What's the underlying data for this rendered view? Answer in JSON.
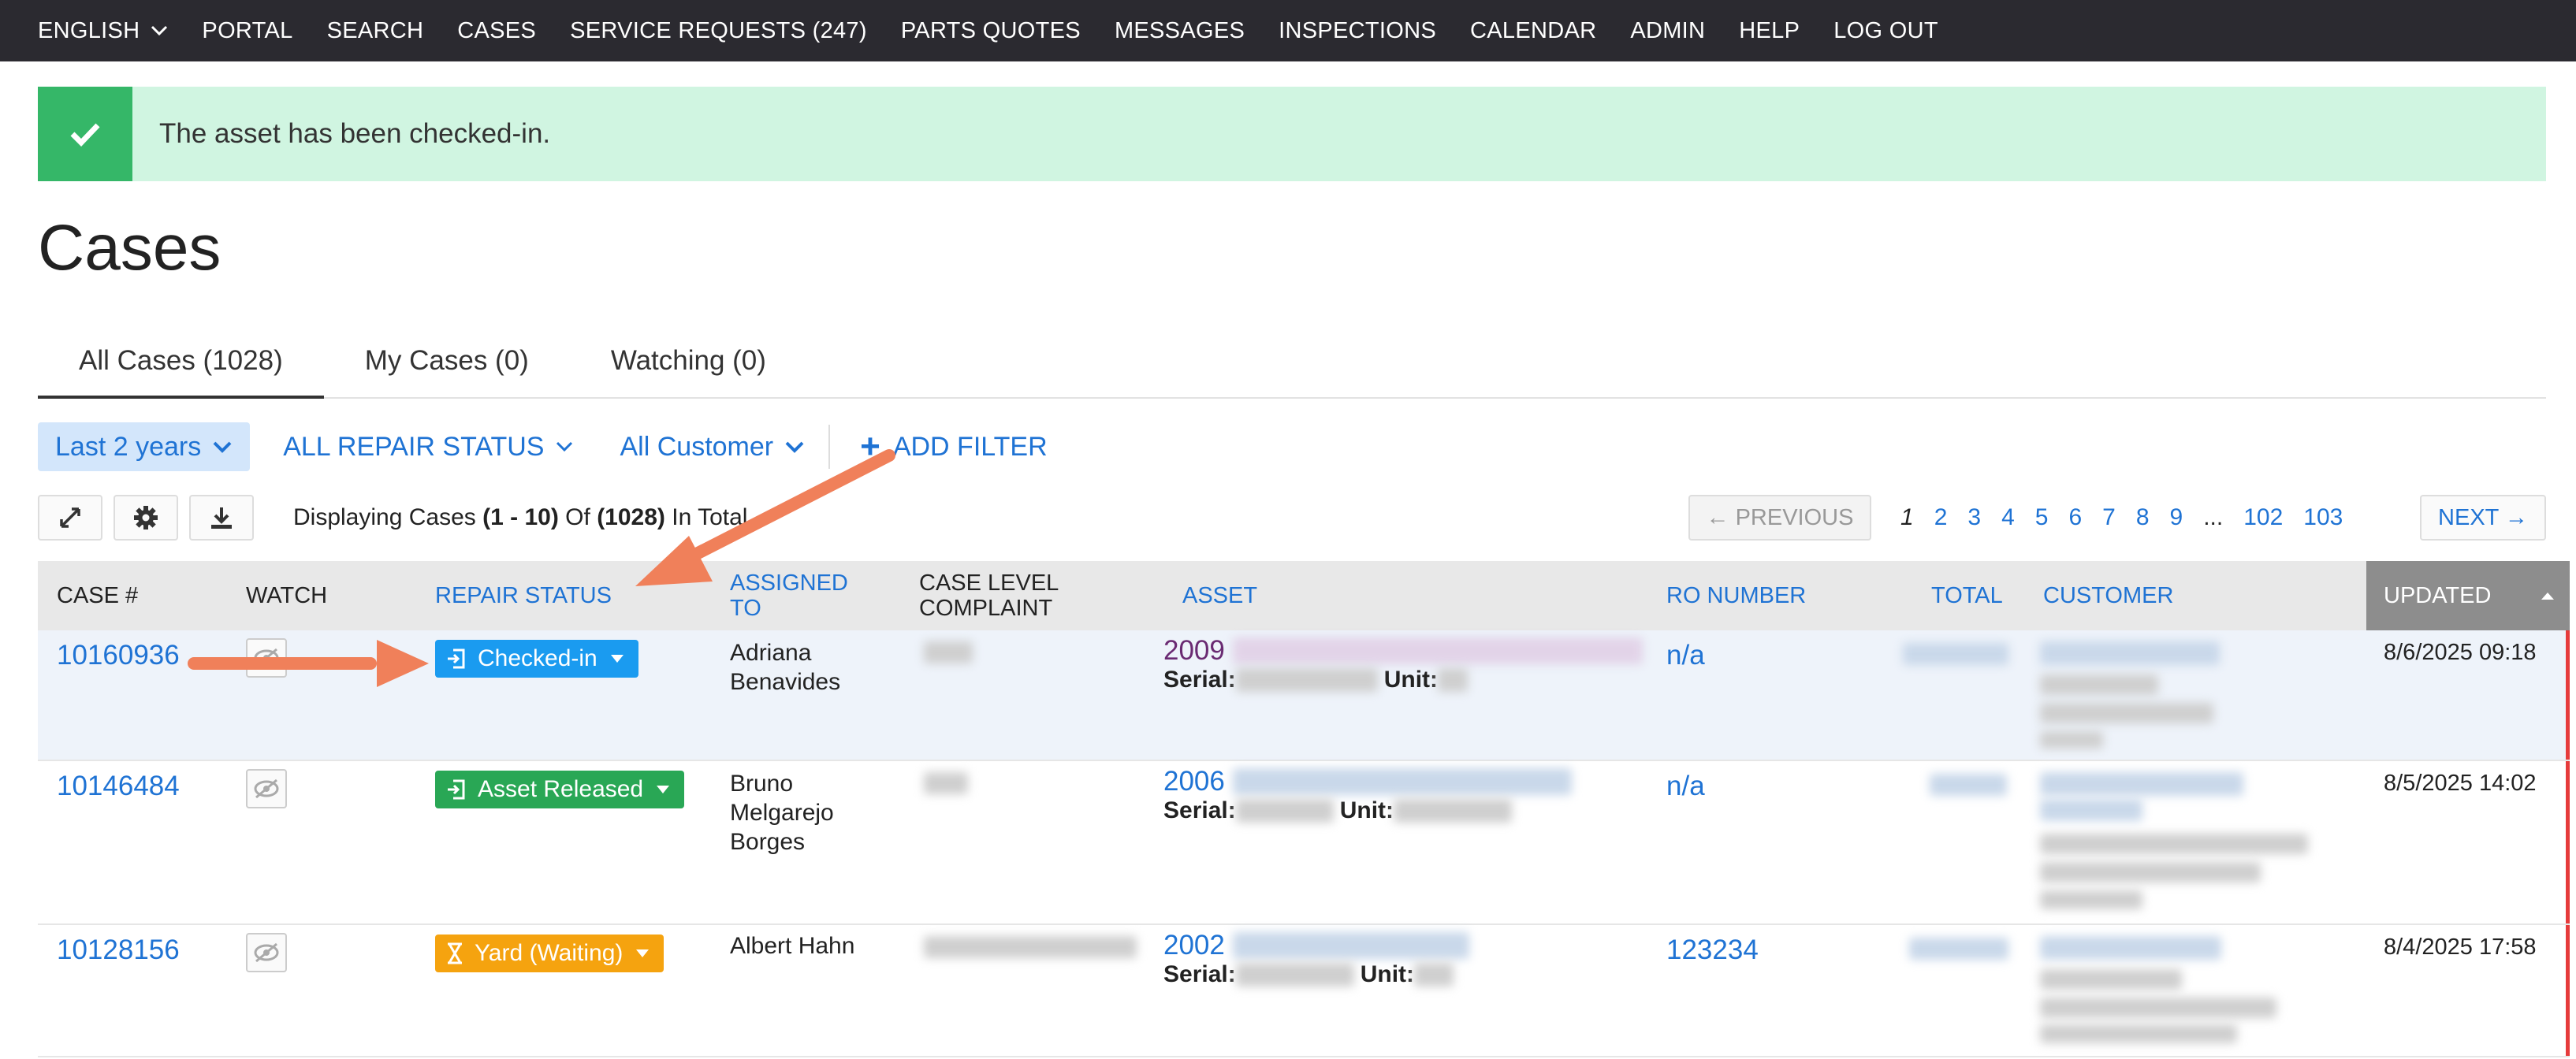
{
  "nav": {
    "items": [
      {
        "label": "ENGLISH",
        "dropdown": true
      },
      {
        "label": "PORTAL"
      },
      {
        "label": "SEARCH"
      },
      {
        "label": "CASES"
      },
      {
        "label": "SERVICE REQUESTS (247)"
      },
      {
        "label": "PARTS QUOTES"
      },
      {
        "label": "MESSAGES"
      },
      {
        "label": "INSPECTIONS"
      },
      {
        "label": "CALENDAR"
      },
      {
        "label": "ADMIN"
      },
      {
        "label": "HELP"
      },
      {
        "label": "LOG OUT"
      }
    ]
  },
  "alert": {
    "text": "The asset has been checked-in.",
    "icon": "check-icon",
    "color": "#35b768",
    "background": "#d0f5e1"
  },
  "page": {
    "title": "Cases"
  },
  "tabs": [
    {
      "label": "All Cases (1028)",
      "active": true
    },
    {
      "label": "My Cases (0)"
    },
    {
      "label": "Watching (0)"
    }
  ],
  "filters": {
    "date_range": "Last 2 years",
    "repair_status": "ALL REPAIR STATUS",
    "customer": "All Customer",
    "add_filter": "ADD FILTER"
  },
  "toolbar": {
    "icons": [
      "expand-icon",
      "gear-icon",
      "download-icon"
    ],
    "display_prefix": "Displaying Cases",
    "display_range": "(1 - 10)",
    "display_of": "Of",
    "display_total": "(1028)",
    "display_suffix": "In Total"
  },
  "pagination": {
    "previous": "← PREVIOUS",
    "pages": [
      "1",
      "2",
      "3",
      "4",
      "5",
      "6",
      "7",
      "8",
      "9",
      "...",
      "102",
      "103"
    ],
    "current": "1",
    "next": "NEXT →"
  },
  "table": {
    "headers": {
      "case": "CASE #",
      "watch": "WATCH",
      "repair_status": "REPAIR STATUS",
      "assigned_l1": "ASSIGNED",
      "assigned_l2": "TO",
      "complaint_l1": "CASE LEVEL",
      "complaint_l2": "COMPLAINT",
      "asset": "ASSET",
      "ro": "RO NUMBER",
      "total": "TOTAL",
      "customer": "CUSTOMER",
      "updated": "UPDATED"
    },
    "rows": [
      {
        "case": "10160936",
        "status": "Checked-in",
        "status_color": "#1a9bf0",
        "status_icon": "check-in-icon",
        "assigned": [
          "Adriana",
          "Benavides"
        ],
        "asset_year": "2009",
        "serial_label": "Serial:",
        "unit_label": "Unit:",
        "ro": "n/a",
        "updated": "8/6/2025 09:18"
      },
      {
        "case": "10146484",
        "status": "Asset Released",
        "status_color": "#29a755",
        "status_icon": "check-in-icon",
        "assigned": [
          "Bruno",
          "Melgarejo",
          "Borges"
        ],
        "asset_year": "2006",
        "serial_label": "Serial:",
        "unit_label": "Unit:",
        "ro": "n/a",
        "updated": "8/5/2025 14:02"
      },
      {
        "case": "10128156",
        "status": "Yard (Waiting)",
        "status_color": "#f5a30f",
        "status_icon": "hourglass-icon",
        "assigned": [
          "Albert Hahn"
        ],
        "asset_year": "2002",
        "serial_label": "Serial:",
        "unit_label": "Unit:",
        "ro": "123234",
        "updated": "8/4/2025 17:58"
      }
    ]
  },
  "annotations": {
    "arrow_color": "#f0805a"
  }
}
